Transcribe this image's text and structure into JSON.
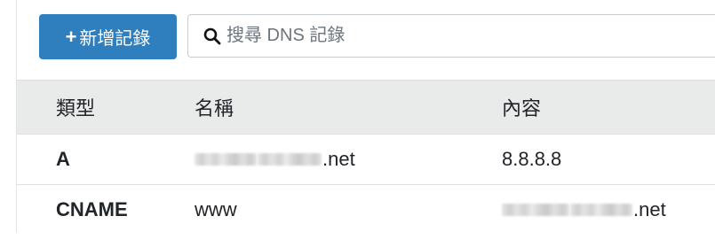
{
  "toolbar": {
    "add_button_icon": "plus-icon",
    "add_button_label": "新增記錄",
    "search_icon": "search-icon",
    "search_placeholder": "搜尋 DNS 記錄"
  },
  "table": {
    "headers": {
      "type": "類型",
      "name": "名稱",
      "content": "內容"
    },
    "rows": [
      {
        "type": "A",
        "name_visible": ".net",
        "name_redacted": true,
        "content": "8.8.8.8",
        "content_redacted": false
      },
      {
        "type": "CNAME",
        "name_visible": "www",
        "name_redacted": false,
        "content": ".net",
        "content_redacted": true
      }
    ]
  },
  "colors": {
    "accent": "#2f7fbf",
    "header_bg": "#e9ebea"
  }
}
